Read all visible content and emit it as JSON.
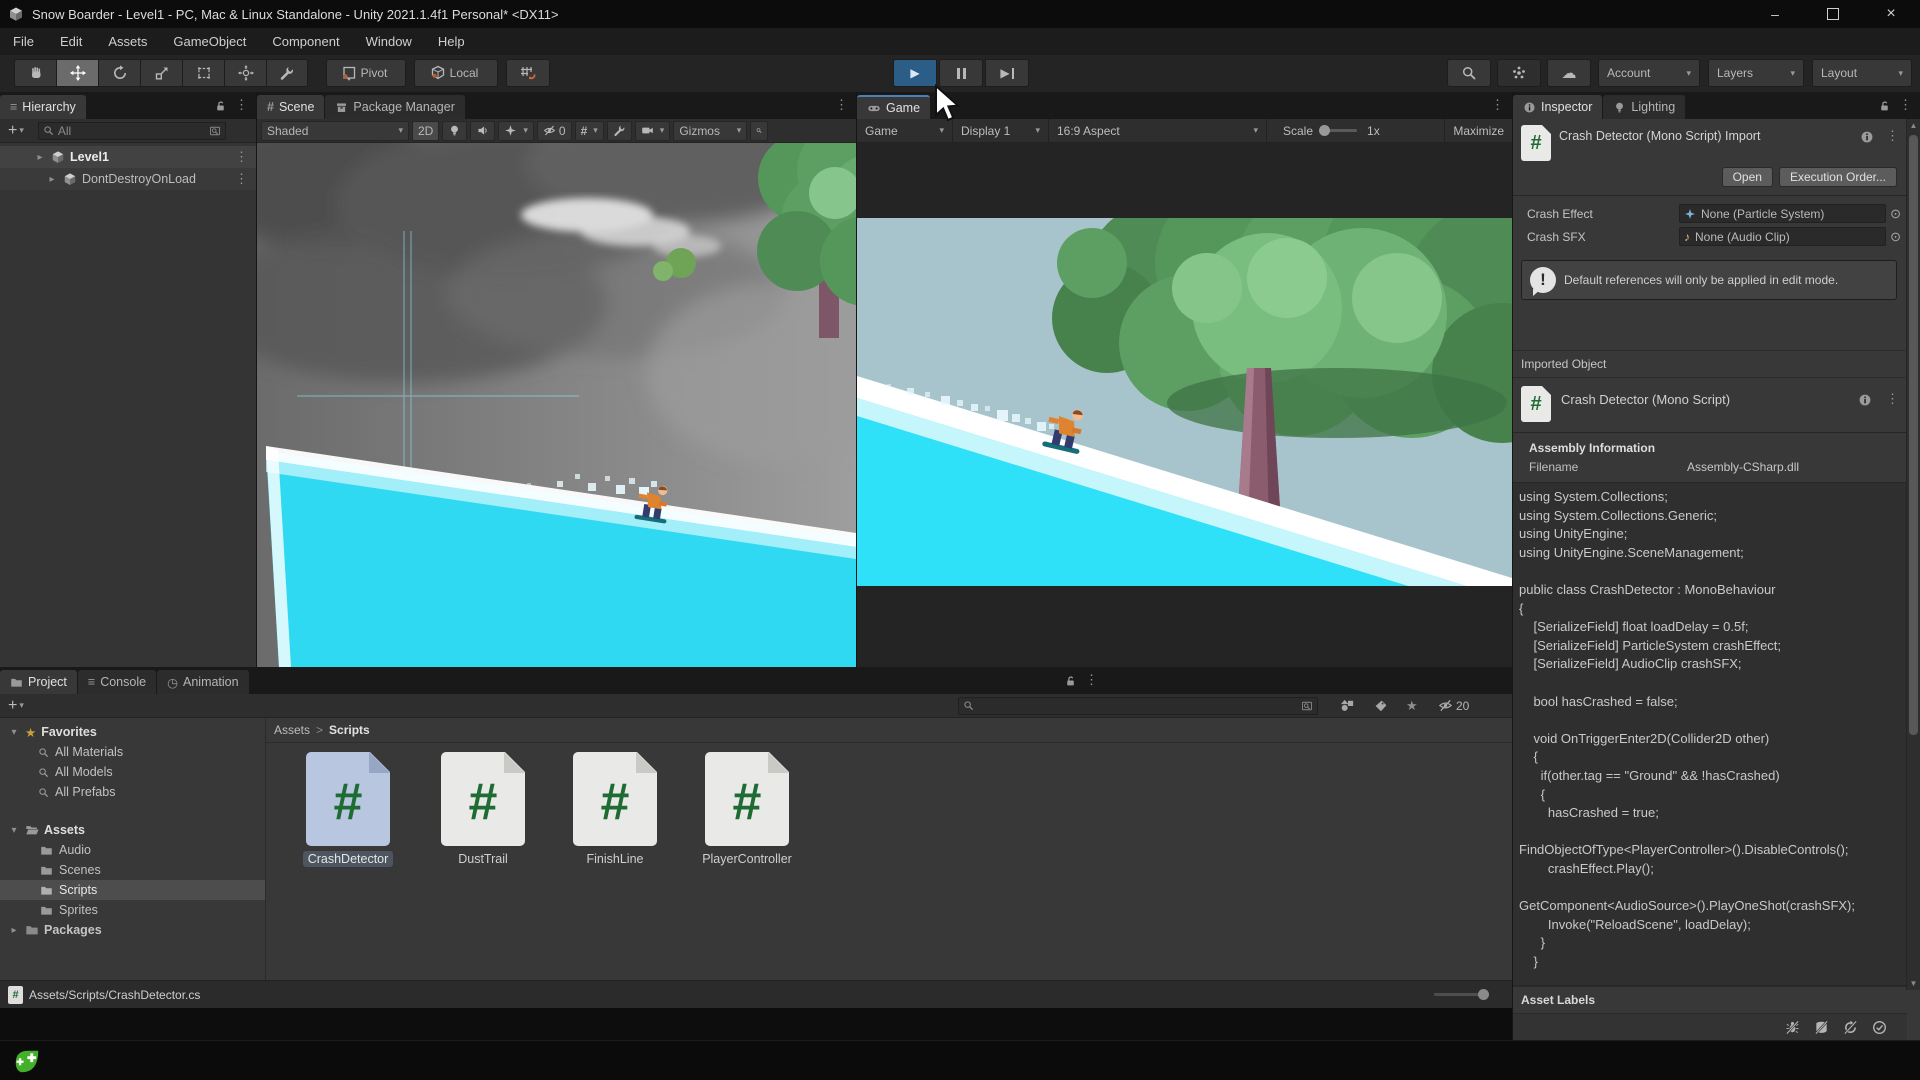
{
  "icons": {
    "play": "▶",
    "kebab": "⋮",
    "dropdown": "▾",
    "collapsed_arrow": "▸",
    "star": "★",
    "note": "♪",
    "picker": "⊙",
    "clock": "◷",
    "hash": "#",
    "console": "≡",
    "cloud": "☁",
    "plus": "+",
    "chevron": ">",
    "minimize": "–",
    "close": "×",
    "exclaim": "!",
    "up_arrow": "▲",
    "down_arrow": "▼"
  },
  "window": {
    "title": "Snow Boarder - Level1 - PC, Mac & Linux Standalone - Unity 2021.1.4f1 Personal* <DX11>",
    "menus": [
      "File",
      "Edit",
      "Assets",
      "GameObject",
      "Component",
      "Window",
      "Help"
    ]
  },
  "toolbar": {
    "pivot": "Pivot",
    "local": "Local",
    "account": "Account",
    "layers": "Layers",
    "layout": "Layout"
  },
  "hierarchy": {
    "tab": "Hierarchy",
    "search_placeholder": "All",
    "items": [
      "Level1",
      "DontDestroyOnLoad"
    ]
  },
  "scene_panel": {
    "tab_scene": "Scene",
    "tab_package_manager": "Package Manager",
    "shaded": "Shaded",
    "mode_2d": "2D",
    "hidden_count": "0",
    "gizmos": "Gizmos"
  },
  "game_panel": {
    "tab": "Game",
    "display_mode": "Game",
    "display": "Display 1",
    "aspect": "16:9 Aspect",
    "scale_label": "Scale",
    "scale_value": "1x",
    "maximize": "Maximize"
  },
  "project": {
    "tab_project": "Project",
    "tab_console": "Console",
    "tab_animation": "Animation",
    "favorites_label": "Favorites",
    "favorites": [
      "All Materials",
      "All Models",
      "All Prefabs"
    ],
    "assets_label": "Assets",
    "folders": [
      "Audio",
      "Scenes",
      "Scripts",
      "Sprites"
    ],
    "packages_label": "Packages",
    "breadcrumb_root": "Assets",
    "breadcrumb_current": "Scripts",
    "files": [
      "CrashDetector",
      "DustTrail",
      "FinishLine",
      "PlayerController"
    ],
    "selected_file": "CrashDetector",
    "footer_path": "Assets/Scripts/CrashDetector.cs",
    "hidden_count": "20"
  },
  "inspector": {
    "tab_inspector": "Inspector",
    "tab_lighting": "Lighting",
    "import_title": "Crash Detector (Mono Script) Import",
    "open": "Open",
    "execution_order": "Execution Order...",
    "crash_effect_label": "Crash Effect",
    "crash_effect_value": "None (Particle System)",
    "crash_sfx_label": "Crash SFX",
    "crash_sfx_value": "None (Audio Clip)",
    "info_message": "Default references will only be applied in edit mode.",
    "imported_object": "Imported Object",
    "object_title": "Crash Detector (Mono Script)",
    "assembly_information": "Assembly Information",
    "filename_label": "Filename",
    "filename_value": "Assembly-CSharp.dll",
    "code": "using System.Collections;\nusing System.Collections.Generic;\nusing UnityEngine;\nusing UnityEngine.SceneManagement;\n\npublic class CrashDetector : MonoBehaviour\n{\n    [SerializeField] float loadDelay = 0.5f;\n    [SerializeField] ParticleSystem crashEffect;\n    [SerializeField] AudioClip crashSFX;\n\n    bool hasCrashed = false;\n\n    void OnTriggerEnter2D(Collider2D other)\n    {\n      if(other.tag == \"Ground\" && !hasCrashed)\n      {\n        hasCrashed = true;\n\nFindObjectOfType<PlayerController>().DisableControls();\n        crashEffect.Play();\n\nGetComponent<AudioSource>().PlayOneShot(crashSFX);\n        Invoke(\"ReloadScene\", loadDelay);\n      }\n    }",
    "asset_labels": "Asset Labels"
  },
  "colors": {
    "selection_blue": "#2c5d87",
    "slope_cyan": "#2ee0f8",
    "game_sky": "#a7c4cc",
    "script_green": "#1e6b34",
    "plastic_green": "#44b02a"
  }
}
